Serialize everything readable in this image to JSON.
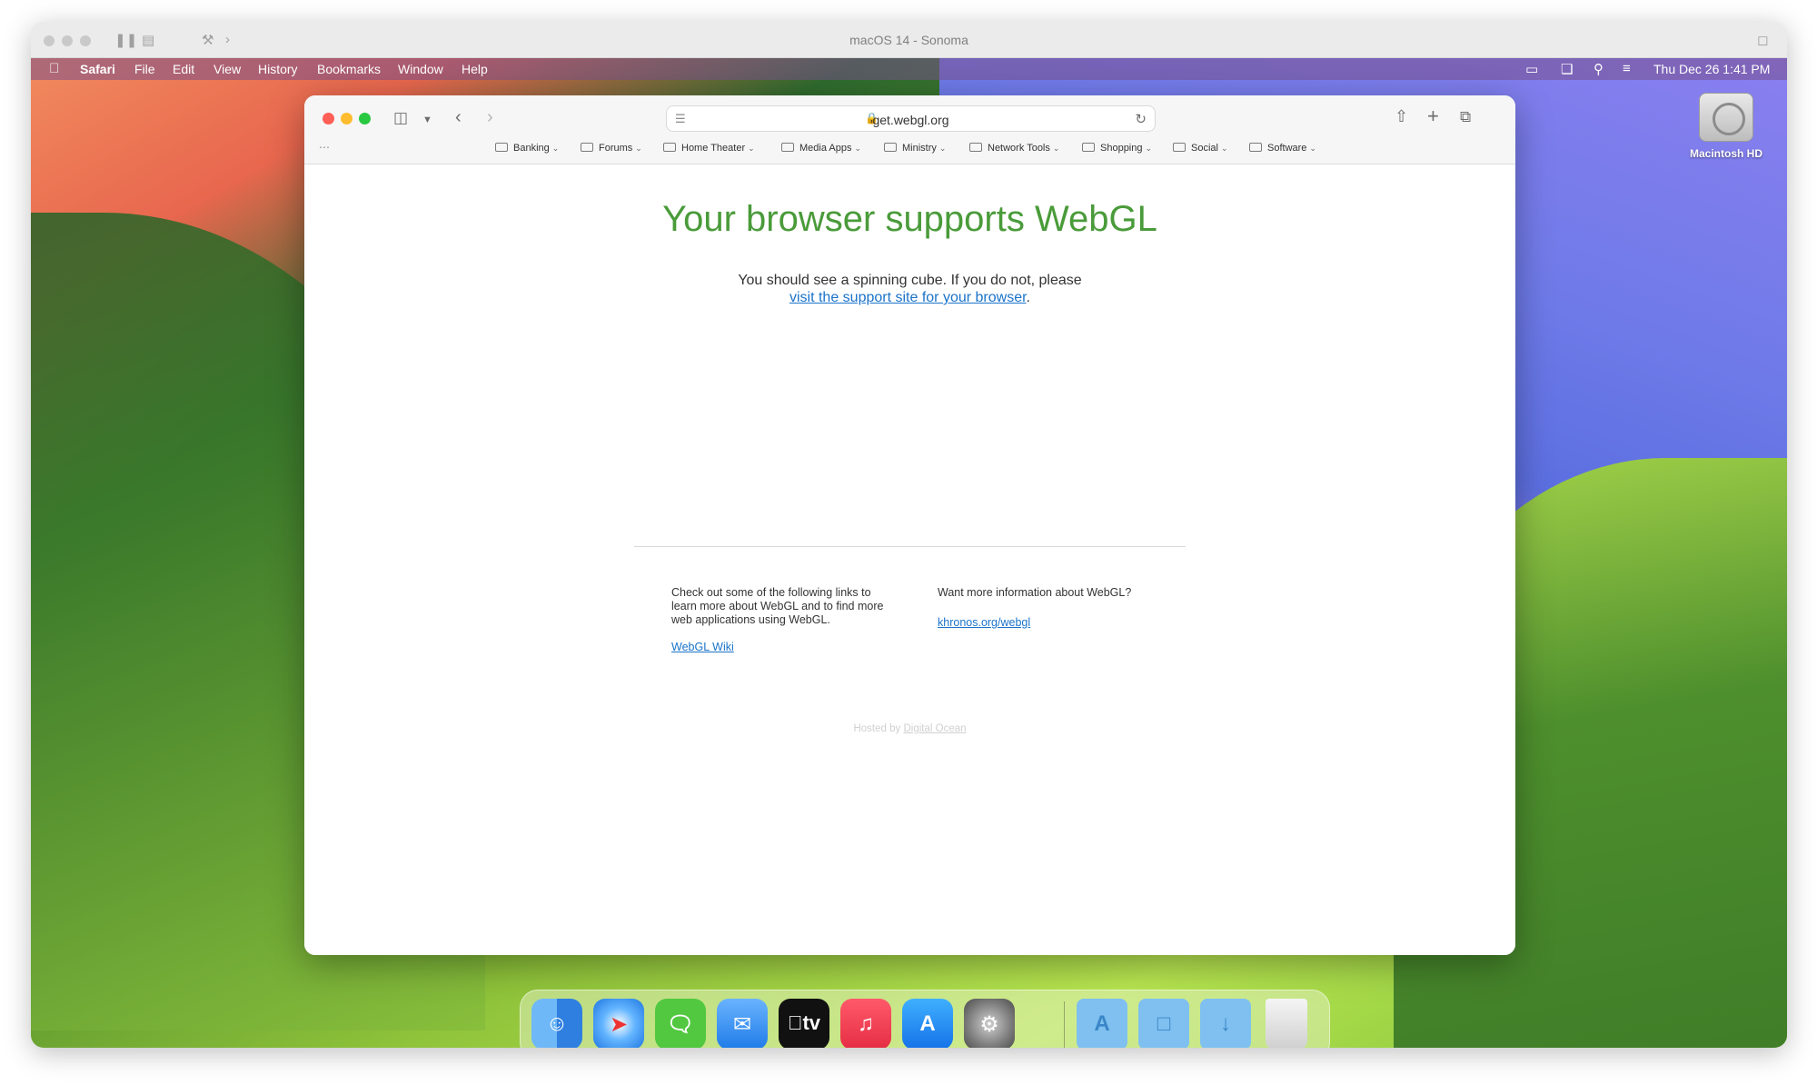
{
  "vm": {
    "title": "macOS 14 - Sonoma"
  },
  "menubar": {
    "items": [
      "Safari",
      "File",
      "Edit",
      "View",
      "History",
      "Bookmarks",
      "Window",
      "Help"
    ],
    "clock": "Thu Dec 26  1:41 PM"
  },
  "desktop": {
    "drive_label": "Macintosh HD"
  },
  "browser": {
    "url": "get.webgl.org",
    "bookmarks": [
      "Banking",
      "Forums",
      "Home Theater",
      "Media Apps",
      "Ministry",
      "Network Tools",
      "Shopping",
      "Social",
      "Software"
    ]
  },
  "page": {
    "headline": "Your browser supports WebGL",
    "sub_text": "You should see a spinning cube. If you do not, please",
    "support_link": "visit the support site for your browser",
    "support_suffix": ".",
    "col1_text": "Check out some of the following links to learn more about WebGL and to find more web applications using WebGL.",
    "col1_link": "WebGL Wiki",
    "col2_text": "Want more information about WebGL?",
    "col2_link": "khronos.org/webgl",
    "hosted_prefix": "Hosted by",
    "hosted_link": "Digital Ocean"
  },
  "dock": {
    "apps": [
      "finder-icon",
      "safari-icon",
      "messages-icon",
      "mail-icon",
      "apple-tv-icon",
      "music-icon",
      "app-store-icon",
      "system-settings-icon"
    ],
    "tv_label": "tv",
    "colors": {
      "finder": "#3d8ef0",
      "safari": "#2f8be8",
      "messages": "#52c840",
      "mail": "#3a8cf0",
      "tv": "#111111",
      "music": "#f0384a",
      "appstore": "#1e8cf5",
      "settings": "#8a8a8a"
    }
  }
}
